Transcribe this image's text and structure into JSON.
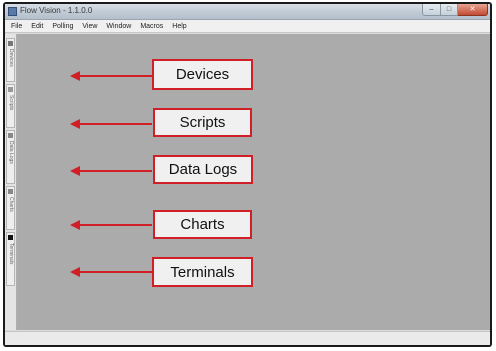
{
  "window": {
    "title": "Flow Vision - 1.1.0.0",
    "minimize_symbol": "–",
    "maximize_symbol": "□",
    "close_symbol": "✕"
  },
  "menu": [
    "File",
    "Edit",
    "Polling",
    "View",
    "Window",
    "Macros",
    "Help"
  ],
  "sidebar_tabs": [
    "Devices",
    "Scripts",
    "Data Logs",
    "Charts",
    "Terminals"
  ],
  "callouts": [
    "Devices",
    "Scripts",
    "Data Logs",
    "Charts",
    "Terminals"
  ],
  "colors": {
    "callout_border": "#d01f26",
    "arrow": "#d01f26",
    "workspace": "#ababab",
    "callout_fill": "#f0f0f0"
  }
}
